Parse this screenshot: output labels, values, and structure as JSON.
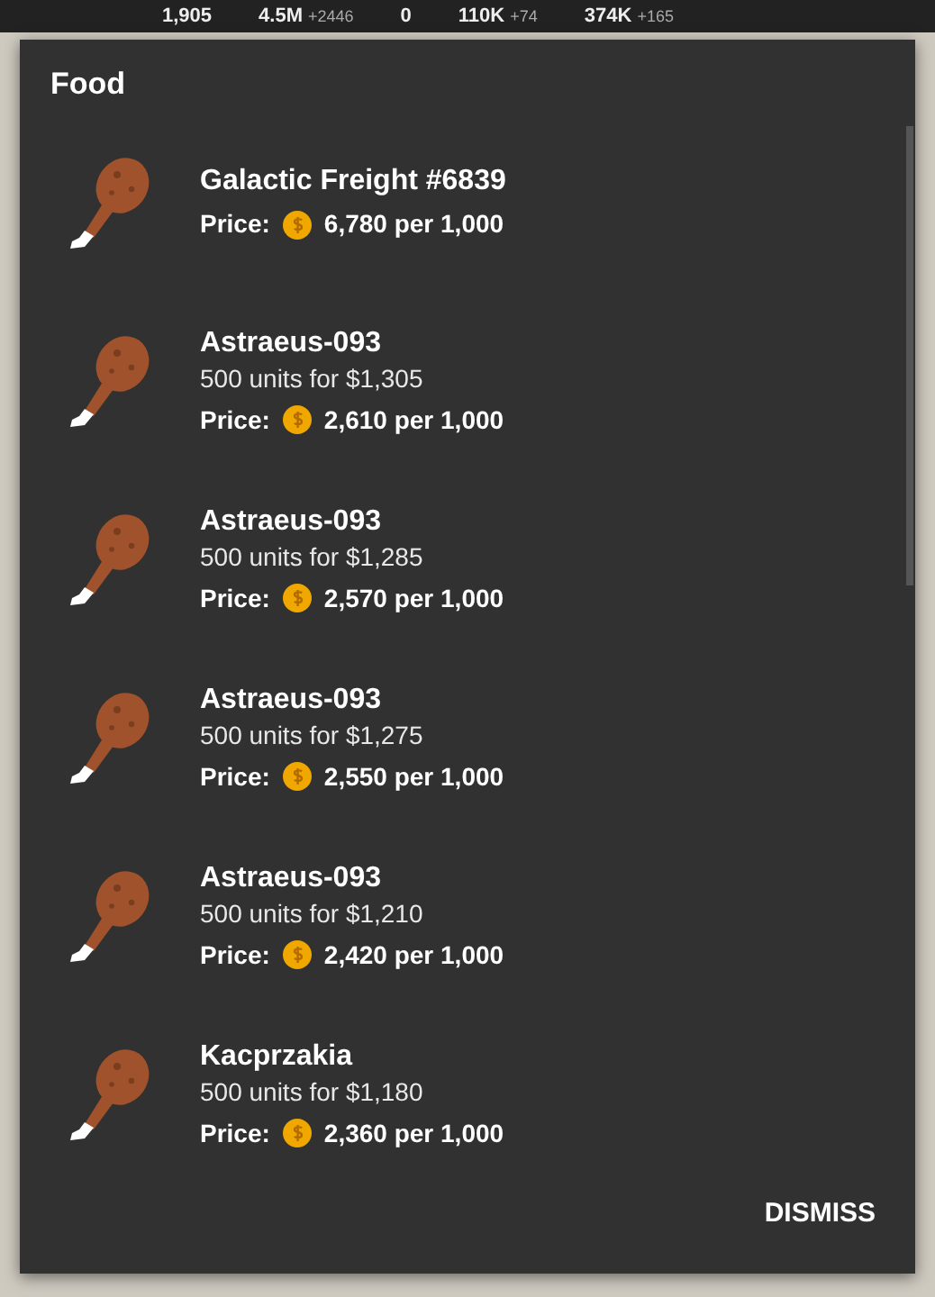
{
  "stats_bar": [
    {
      "value": "1,905"
    },
    {
      "value": "4.5M",
      "delta": "+2446"
    },
    {
      "value": "0"
    },
    {
      "value": "110K",
      "delta": "+74"
    },
    {
      "value": "374K",
      "delta": "+165"
    }
  ],
  "dialog": {
    "title": "Food",
    "offers": [
      {
        "name": "Galactic Freight #6839",
        "price_label": "Price:",
        "price": "6,780 per 1,000"
      },
      {
        "name": "Astraeus-093",
        "detail": "500 units for $1,305",
        "price_label": "Price:",
        "price": "2,610 per 1,000"
      },
      {
        "name": "Astraeus-093",
        "detail": "500 units for $1,285",
        "price_label": "Price:",
        "price": "2,570 per 1,000"
      },
      {
        "name": "Astraeus-093",
        "detail": "500 units for $1,275",
        "price_label": "Price:",
        "price": "2,550 per 1,000"
      },
      {
        "name": "Astraeus-093",
        "detail": "500 units for $1,210",
        "price_label": "Price:",
        "price": "2,420 per 1,000"
      },
      {
        "name": "Kacprzakia",
        "detail": "500 units for $1,180",
        "price_label": "Price:",
        "price": "2,360 per 1,000"
      }
    ],
    "button": "DISMISS"
  }
}
